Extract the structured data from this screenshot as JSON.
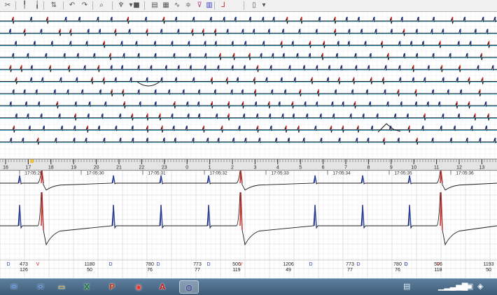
{
  "toolbar": {
    "icons": [
      "scissors-icon",
      "marker-icon",
      "marker2-icon",
      "marker3-icon",
      "undo-icon",
      "redo-icon",
      "zoom-icon",
      "pin-icon",
      "dropdown-icon",
      "save-icon",
      "printer-icon",
      "grid-icon",
      "wave-icon",
      "level-icon",
      "filter-icon",
      "histogram-icon",
      "graph-icon",
      "new-page-icon",
      "dropdown2-icon"
    ]
  },
  "ruler": {
    "ticks": [
      "16",
      "17",
      "18",
      "19",
      "20",
      "21",
      "22",
      "23",
      "0",
      "1",
      "2",
      "3",
      "4",
      "5",
      "6",
      "7",
      "8",
      "9",
      "10",
      "11",
      "12",
      "13"
    ],
    "times": [
      "17:05:29",
      "17:05:30",
      "17:05:31",
      "17:05:32",
      "17:05:33",
      "17:05:34",
      "17:05:35",
      "17:05:36"
    ]
  },
  "beats": [
    {
      "label": "D",
      "top": "473",
      "bottom": "126",
      "color": "#2a3f9f"
    },
    {
      "label": "V",
      "top": "",
      "bottom": "",
      "color": "#c62828"
    },
    {
      "label": "",
      "top": "1180",
      "bottom": "50",
      "color": "#333333"
    },
    {
      "label": "D",
      "top": "",
      "bottom": "",
      "color": "#2a3f9f"
    },
    {
      "label": "",
      "top": "780",
      "bottom": "76",
      "color": "#333333"
    },
    {
      "label": "D",
      "top": "",
      "bottom": "",
      "color": "#2a3f9f"
    },
    {
      "label": "",
      "top": "773",
      "bottom": "77",
      "color": "#333333"
    },
    {
      "label": "D",
      "top": "",
      "bottom": "",
      "color": "#2a3f9f"
    },
    {
      "label": "",
      "top": "500",
      "bottom": "119",
      "color": "#333333"
    },
    {
      "label": "V",
      "top": "",
      "bottom": "",
      "color": "#c62828"
    },
    {
      "label": "",
      "top": "1206",
      "bottom": "49",
      "color": "#333333"
    },
    {
      "label": "D",
      "top": "",
      "bottom": "",
      "color": "#2a3f9f"
    },
    {
      "label": "",
      "top": "773",
      "bottom": "77",
      "color": "#333333"
    },
    {
      "label": "D",
      "top": "",
      "bottom": "",
      "color": "#2a3f9f"
    },
    {
      "label": "",
      "top": "780",
      "bottom": "76",
      "color": "#333333"
    },
    {
      "label": "D",
      "top": "",
      "bottom": "",
      "color": "#2a3f9f"
    },
    {
      "label": "",
      "top": "506",
      "bottom": "118",
      "color": "#333333"
    },
    {
      "label": "D",
      "top": "",
      "bottom": "",
      "color": "#2a3f9f"
    },
    {
      "label": "V",
      "top": "",
      "bottom": "",
      "color": "#c62828"
    },
    {
      "label": "",
      "top": "1193",
      "bottom": "50",
      "color": "#333333"
    }
  ],
  "colors": {
    "trace": "#1c1c1c",
    "baseline": "#2aa6d8",
    "normal_beat": "#2a3f9f",
    "ventricular_beat": "#c62828",
    "grid": "#dddddd",
    "taskbar": "#4a6a88"
  },
  "taskbar": {
    "apps": [
      "thunderbird-icon",
      "thunderbird2-icon",
      "explorer-folder-icon",
      "excel-icon",
      "powerpoint-icon",
      "chrome-icon",
      "acrobat-icon",
      "ecg-app-icon"
    ],
    "tray_icons": [
      "printer-tray-icon",
      "signal-bars-icon",
      "network-icon",
      "volume-icon"
    ]
  }
}
